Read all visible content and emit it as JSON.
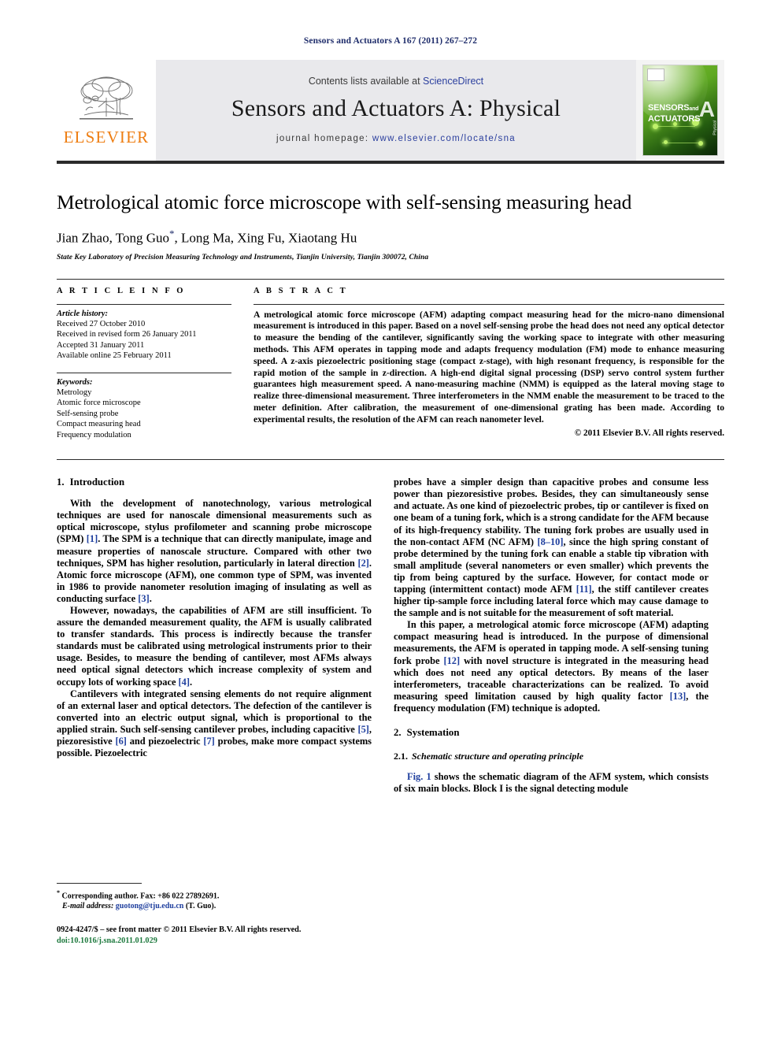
{
  "running_head": "Sensors and Actuators A 167 (2011) 267–272",
  "masthead": {
    "contents_prefix": "Contents lists available at ",
    "contents_link": "ScienceDirect",
    "journal_title": "Sensors and Actuators A: Physical",
    "homepage_prefix": "journal homepage: ",
    "homepage_url": "www.elsevier.com/locate/sna",
    "publisher_logo_text": "ELSEVIER",
    "cover": {
      "line1": "SENSORS",
      "line1_small": "and",
      "line2": "ACTUATORS",
      "volume_letter": "A",
      "subtitle": "Physical"
    }
  },
  "article": {
    "title": "Metrological atomic force microscope with self-sensing measuring head",
    "authors": "Jian Zhao, Tong Guo",
    "authors_after_star": ", Long Ma, Xing Fu, Xiaotang Hu",
    "corresponding_marker": "*",
    "affiliation": "State Key Laboratory of Precision Measuring Technology and Instruments, Tianjin University, Tianjin 300072, China"
  },
  "article_info": {
    "section_label": "A R T I C L E   I N F O",
    "history_heading": "Article history:",
    "history": [
      "Received 27 October 2010",
      "Received in revised form 26 January 2011",
      "Accepted 31 January 2011",
      "Available online 25 February 2011"
    ],
    "keywords_heading": "Keywords:",
    "keywords": [
      "Metrology",
      "Atomic force microscope",
      "Self-sensing probe",
      "Compact measuring head",
      "Frequency modulation"
    ]
  },
  "abstract": {
    "section_label": "A B S T R A C T",
    "text": "A metrological atomic force microscope (AFM) adapting compact measuring head for the micro-nano dimensional measurement is introduced in this paper. Based on a novel self-sensing probe the head does not need any optical detector to measure the bending of the cantilever, significantly saving the working space to integrate with other measuring methods. This AFM operates in tapping mode and adapts frequency modulation (FM) mode to enhance measuring speed. A z-axis piezoelectric positioning stage (compact z-stage), with high resonant frequency, is responsible for the rapid motion of the sample in z-direction. A high-end digital signal processing (DSP) servo control system further guarantees high measurement speed. A nano-measuring machine (NMM) is equipped as the lateral moving stage to realize three-dimensional measurement. Three interferometers in the NMM enable the measurement to be traced to the meter definition. After calibration, the measurement of one-dimensional grating has been made. According to experimental results, the resolution of the AFM can reach nanometer level.",
    "copyright": "© 2011 Elsevier B.V. All rights reserved."
  },
  "sections": {
    "intro_number": "1.",
    "intro_title": "Introduction",
    "systemation_number": "2.",
    "systemation_title": "Systemation",
    "subsection_number": "2.1.",
    "subsection_title": "Schematic structure and operating principle"
  },
  "body": {
    "left": [
      {
        "id": "p1",
        "parts": [
          {
            "t": "With the development of nanotechnology, various metrological techniques are used for nanoscale dimensional measurements such as optical microscope, stylus profilometer and scanning probe microscope (SPM) "
          },
          {
            "t": "[1]",
            "ref": true
          },
          {
            "t": ". The SPM is a technique that can directly manipulate, image and measure properties of nanoscale structure. Compared with other two techniques, SPM has higher resolution, particularly in lateral direction "
          },
          {
            "t": "[2]",
            "ref": true
          },
          {
            "t": ". Atomic force microscope (AFM), one common type of SPM, was invented in 1986 to provide nanometer resolution imaging of insulating as well as conducting surface "
          },
          {
            "t": "[3]",
            "ref": true
          },
          {
            "t": "."
          }
        ]
      },
      {
        "id": "p2",
        "parts": [
          {
            "t": "However, nowadays, the capabilities of AFM are still insufficient. To assure the demanded measurement quality, the AFM is usually calibrated to transfer standards. This process is indirectly because the transfer standards must be calibrated using metrological instruments prior to their usage. Besides, to measure the bending of cantilever, most AFMs always need optical signal detectors which increase complexity of system and occupy lots of working space "
          },
          {
            "t": "[4]",
            "ref": true
          },
          {
            "t": "."
          }
        ]
      },
      {
        "id": "p3",
        "parts": [
          {
            "t": "Cantilevers with integrated sensing elements do not require alignment of an external laser and optical detectors. The defection of the cantilever is converted into an electric output signal, which is proportional to the applied strain. Such self-sensing cantilever probes, including capacitive "
          },
          {
            "t": "[5]",
            "ref": true
          },
          {
            "t": ", piezoresistive "
          },
          {
            "t": "[6]",
            "ref": true
          },
          {
            "t": " and piezoelectric "
          },
          {
            "t": "[7]",
            "ref": true
          },
          {
            "t": " probes, make more compact systems possible. Piezoelectric"
          }
        ]
      }
    ],
    "right": [
      {
        "id": "p4",
        "indent": false,
        "parts": [
          {
            "t": "probes have a simpler design than capacitive probes and consume less power than piezoresistive probes. Besides, they can simultaneously sense and actuate. As one kind of piezoelectric probes, tip or cantilever is fixed on one beam of a tuning fork, which is a strong candidate for the AFM because of its high-frequency stability. The tuning fork probes are usually used in the non-contact AFM (NC AFM) "
          },
          {
            "t": "[8–10]",
            "ref": true
          },
          {
            "t": ", since the high spring constant of probe determined by the tuning fork can enable a stable tip vibration with small amplitude (several nanometers or even smaller) which prevents the tip from being captured by the surface. However, for contact mode or tapping (intermittent contact) mode AFM "
          },
          {
            "t": "[11]",
            "ref": true
          },
          {
            "t": ", the stiff cantilever creates higher tip-sample force including lateral force which may cause damage to the sample and is not suitable for the measurement of soft material."
          }
        ]
      },
      {
        "id": "p5",
        "indent": true,
        "parts": [
          {
            "t": "In this paper, a metrological atomic force microscope (AFM) adapting compact measuring head is introduced. In the purpose of dimensional measurements, the AFM is operated in tapping mode. A self-sensing tuning fork probe "
          },
          {
            "t": "[12]",
            "ref": true
          },
          {
            "t": " with novel structure is integrated in the measuring head which does not need any optical detectors. By means of the laser interferometers, traceable characterizations can be realized. To avoid measuring speed limitation caused by high quality factor "
          },
          {
            "t": "[13]",
            "ref": true
          },
          {
            "t": ", the frequency modulation (FM) technique is adopted."
          }
        ]
      },
      {
        "id": "p6",
        "indent": true,
        "parts": [
          {
            "t": "",
            "fig": true
          },
          {
            "t": "Fig. 1",
            "ref": true
          },
          {
            "t": " shows the schematic diagram of the AFM system, which consists of six main blocks. Block I is the signal detecting module"
          }
        ]
      }
    ]
  },
  "footnotes": {
    "corresponding_marker": "*",
    "corresponding_text": " Corresponding author. Fax: +86 022 27892691.",
    "email_label": "E-mail address:",
    "email": "guotong@tju.edu.cn",
    "email_suffix": " (T. Guo).",
    "issn_line": "0924-4247/$ – see front matter © 2011 Elsevier B.V. All rights reserved.",
    "doi_prefix": "doi:",
    "doi": "10.1016/j.sna.2011.01.029"
  }
}
